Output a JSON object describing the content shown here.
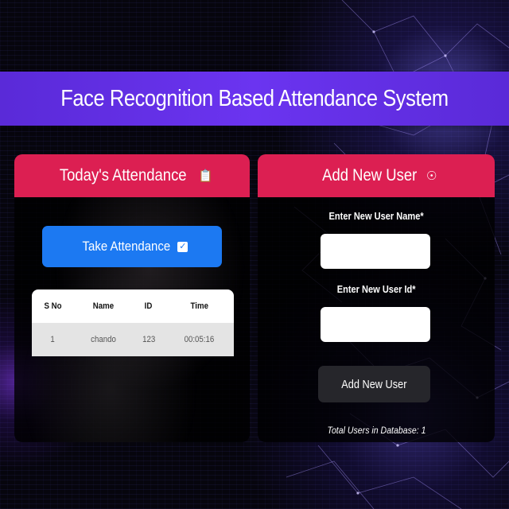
{
  "header": {
    "title": "Face Recognition Based Attendance System"
  },
  "attendance": {
    "heading": "Today's Attendance",
    "heading_icon": "clipboard-icon",
    "take_button": "Take Attendance",
    "take_icon": "check-square-icon",
    "columns": [
      "S No",
      "Name",
      "ID",
      "Time"
    ],
    "rows": [
      {
        "sno": "1",
        "name": "chando",
        "id": "123",
        "time": "00:05:16"
      }
    ]
  },
  "add_user": {
    "heading": "Add New User",
    "heading_icon": "add-user-icon",
    "name_label": "Enter New User Name*",
    "name_value": "",
    "id_label": "Enter New User Id*",
    "id_value": "",
    "button": "Add New User",
    "total_text": "Total Users in Database: 1"
  },
  "colors": {
    "header": "#6b34f0",
    "panel_head": "#dc1f52",
    "take_button": "#1c79f2",
    "add_button": "#26262b"
  }
}
